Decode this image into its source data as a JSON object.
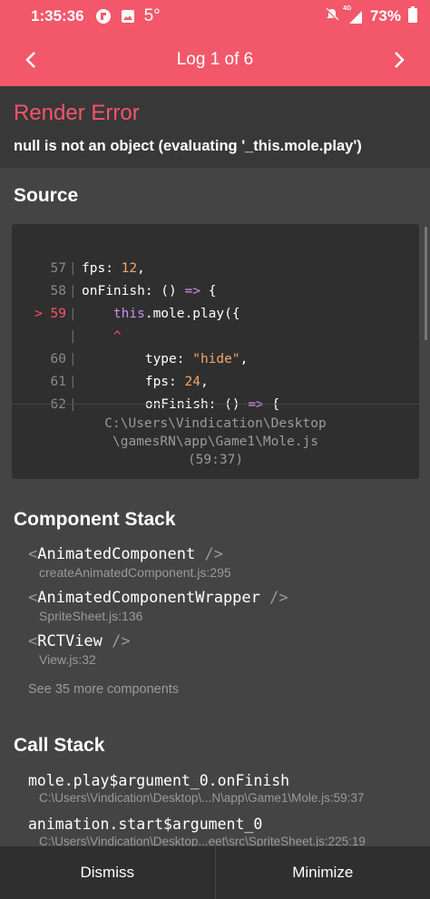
{
  "status_bar": {
    "time": "1:35:36",
    "temperature": "5°",
    "battery_percent": "73%",
    "network": "4G"
  },
  "header": {
    "title": "Log 1 of 6"
  },
  "error": {
    "title": "Render Error",
    "message": "null is not an object (evaluating '_this.mole.play')"
  },
  "source": {
    "section_title": "Source",
    "lines": [
      {
        "number": "57",
        "marker": "",
        "code": "fps: 12,"
      },
      {
        "number": "58",
        "marker": "",
        "code": "onFinish: () => {"
      },
      {
        "number": "59",
        "marker": ">",
        "code": "    this.mole.play({"
      },
      {
        "number": "",
        "marker": "",
        "code": "    ^"
      },
      {
        "number": "60",
        "marker": "",
        "code": "        type: \"hide\","
      },
      {
        "number": "61",
        "marker": "",
        "code": "        fps: 24,"
      },
      {
        "number": "62",
        "marker": "",
        "code": "        onFinish: () => {"
      }
    ],
    "file_line1": "C:\\Users\\Vindication\\Desktop",
    "file_line2": "\\gamesRN\\app\\Game1\\Mole.js",
    "file_line3": "(59:37)"
  },
  "component_stack": {
    "section_title": "Component Stack",
    "items": [
      {
        "name": "AnimatedComponent",
        "file": "createAnimatedComponent.js:295"
      },
      {
        "name": "AnimatedComponentWrapper",
        "file": "SpriteSheet.js:136"
      },
      {
        "name": "RCTView",
        "file": "View.js:32"
      }
    ],
    "more_label": "See 35 more components"
  },
  "call_stack": {
    "section_title": "Call Stack",
    "items": [
      {
        "name": "mole.play$argument_0.onFinish",
        "file": "C:\\Users\\Vindication\\Desktop\\...N\\app\\Game1\\Mole.js:59:37"
      },
      {
        "name": "animation.start$argument_0",
        "file": "C:\\Users\\Vindication\\Desktop...eet\\src\\SpriteSheet.js:225:19"
      }
    ]
  },
  "footer": {
    "dismiss_label": "Dismiss",
    "minimize_label": "Minimize"
  },
  "colors": {
    "accent": "#f2586a",
    "error_text": "#f6546a",
    "background": "#444444",
    "code_background": "#2f2f2f"
  }
}
